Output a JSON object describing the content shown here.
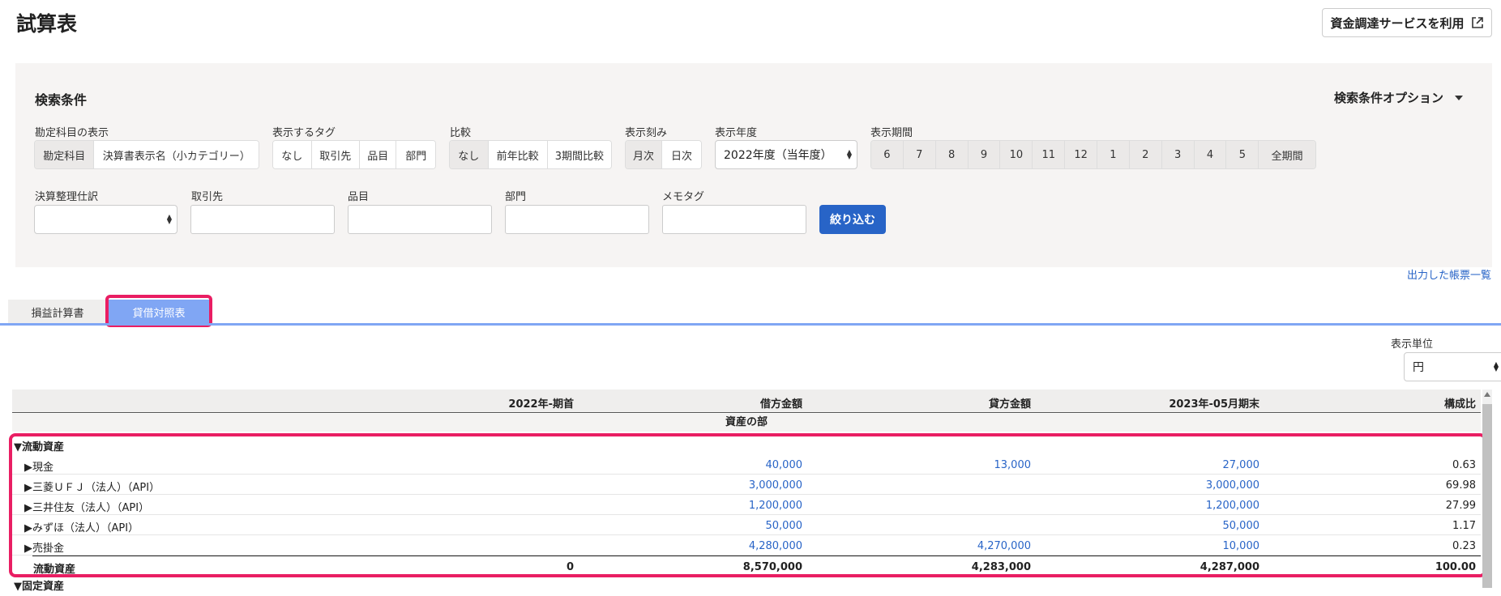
{
  "page": {
    "title": "試算表",
    "fund_button": "資金調達サービスを利用",
    "output_link": "出力した帳票一覧"
  },
  "search": {
    "title": "検索条件",
    "options_label": "検索条件オプション",
    "account_display": {
      "label": "勘定科目の表示",
      "options": [
        "勘定科目",
        "決算書表示名（小カテゴリー）"
      ]
    },
    "tags": {
      "label": "表示するタグ",
      "options": [
        "なし",
        "取引先",
        "品目",
        "部門"
      ]
    },
    "compare": {
      "label": "比較",
      "options": [
        "なし",
        "前年比較",
        "3期間比較"
      ]
    },
    "granularity": {
      "label": "表示刻み",
      "options": [
        "月次",
        "日次"
      ]
    },
    "fiscal_year": {
      "label": "表示年度",
      "value": "2022年度（当年度）"
    },
    "period": {
      "label": "表示期間",
      "options": [
        "6",
        "7",
        "8",
        "9",
        "10",
        "11",
        "12",
        "1",
        "2",
        "3",
        "4",
        "5",
        "全期間"
      ]
    },
    "adjusting": {
      "label": "決算整理仕訳",
      "value": ""
    },
    "partner": {
      "label": "取引先"
    },
    "item": {
      "label": "品目"
    },
    "department": {
      "label": "部門"
    },
    "memo_tag": {
      "label": "メモタグ"
    },
    "filter_button": "絞り込む"
  },
  "tabs": [
    "損益計算書",
    "貸借対照表"
  ],
  "unit": {
    "label": "表示単位",
    "value": "円"
  },
  "table": {
    "headers": [
      "2022年-期首",
      "借方金額",
      "貸方金額",
      "2023年-05月期末",
      "構成比"
    ],
    "section": "資産の部",
    "group": "▼流動資産",
    "rows": [
      {
        "name": "▶現金",
        "opening": "",
        "debit": "40,000",
        "credit": "13,000",
        "closing": "27,000",
        "ratio": "0.63"
      },
      {
        "name": "▶三菱ＵＦＪ（法人）（API）",
        "opening": "",
        "debit": "3,000,000",
        "credit": "",
        "closing": "3,000,000",
        "ratio": "69.98"
      },
      {
        "name": "▶三井住友（法人）（API）",
        "opening": "",
        "debit": "1,200,000",
        "credit": "",
        "closing": "1,200,000",
        "ratio": "27.99"
      },
      {
        "name": "▶みずほ（法人）（API）",
        "opening": "",
        "debit": "50,000",
        "credit": "",
        "closing": "50,000",
        "ratio": "1.17"
      },
      {
        "name": "▶売掛金",
        "opening": "",
        "debit": "4,280,000",
        "credit": "4,270,000",
        "closing": "10,000",
        "ratio": "0.23"
      }
    ],
    "total": {
      "name": "流動資産",
      "opening": "0",
      "debit": "8,570,000",
      "credit": "4,283,000",
      "closing": "4,287,000",
      "ratio": "100.00"
    },
    "next_group": "▼固定資産"
  }
}
